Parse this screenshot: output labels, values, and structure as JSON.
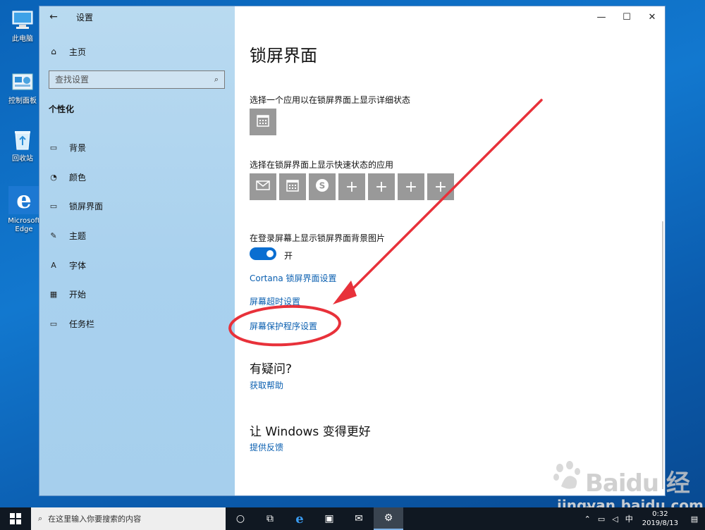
{
  "desktop": {
    "icons": [
      {
        "label": "此电脑"
      },
      {
        "label": "控制面板"
      },
      {
        "label": "回收站"
      },
      {
        "label": "Microsoft Edge"
      }
    ]
  },
  "window": {
    "title": "设置",
    "sidebar": {
      "home_label": "主页",
      "search_placeholder": "查找设置",
      "section": "个性化",
      "items": [
        {
          "label": "背景",
          "icon": "image-icon"
        },
        {
          "label": "颜色",
          "icon": "palette-icon"
        },
        {
          "label": "锁屏界面",
          "icon": "lock-screen-icon"
        },
        {
          "label": "主题",
          "icon": "theme-icon"
        },
        {
          "label": "字体",
          "icon": "font-icon"
        },
        {
          "label": "开始",
          "icon": "start-icon"
        },
        {
          "label": "任务栏",
          "icon": "taskbar-icon"
        }
      ]
    },
    "main": {
      "title": "锁屏界面",
      "detail_status_label": "选择一个应用以在锁屏界面上显示详细状态",
      "quick_status_label": "选择在锁屏界面上显示快速状态的应用",
      "quick_status_apps": [
        "mail-icon",
        "calendar-icon",
        "skype-icon",
        "plus-icon",
        "plus-icon",
        "plus-icon",
        "plus-icon"
      ],
      "background_toggle_label": "在登录屏幕上显示锁屏界面背景图片",
      "toggle_state": "开",
      "toggle_on": true,
      "links": {
        "cortana": "Cortana 锁屏界面设置",
        "timeout": "屏幕超时设置",
        "screensaver": "屏幕保护程序设置"
      },
      "question_heading": "有疑问?",
      "get_help": "获取帮助",
      "improve_heading": "让 Windows 变得更好",
      "feedback": "提供反馈"
    },
    "annotation_color": "#e8313a"
  },
  "taskbar": {
    "search_placeholder": "在这里输入你要搜索的内容",
    "tray_ime": "中",
    "time": "0:32",
    "date": "2019/8/13"
  },
  "watermark": {
    "brand": "Baidu 经验",
    "url": "jingyan.baidu.com"
  }
}
